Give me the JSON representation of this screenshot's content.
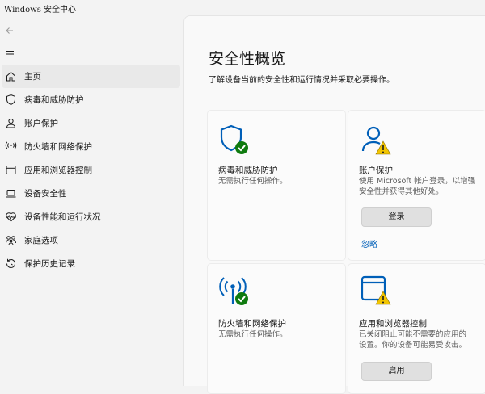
{
  "window": {
    "title": "Windows 安全中心"
  },
  "sidebar": {
    "items": [
      {
        "label": "主页",
        "icon": "home-icon"
      },
      {
        "label": "病毒和威胁防护",
        "icon": "shield-icon"
      },
      {
        "label": "账户保护",
        "icon": "person-icon"
      },
      {
        "label": "防火墙和网络保护",
        "icon": "antenna-icon"
      },
      {
        "label": "应用和浏览器控制",
        "icon": "app-window-icon"
      },
      {
        "label": "设备安全性",
        "icon": "laptop-icon"
      },
      {
        "label": "设备性能和运行状况",
        "icon": "heart-pulse-icon"
      },
      {
        "label": "家庭选项",
        "icon": "family-icon"
      },
      {
        "label": "保护历史记录",
        "icon": "history-icon"
      }
    ]
  },
  "main": {
    "title": "安全性概览",
    "subtitle": "了解设备当前的安全性和运行情况并采取必要操作。",
    "cards": [
      {
        "title": "病毒和威胁防护",
        "desc": [
          "无需执行任何操作。"
        ],
        "status": "ok"
      },
      {
        "title": "账户保护",
        "desc": [
          "使用 Microsoft 帐户登录，以增强",
          "安全性并获得其他好处。"
        ],
        "status": "warning",
        "button": "登录",
        "link": "忽略"
      },
      {
        "title": "防火墙和网络保护",
        "desc": [
          "无需执行任何操作。"
        ],
        "status": "ok"
      },
      {
        "title": "应用和浏览器控制",
        "desc": [
          "已关闭阻止可能不需要的应用的",
          "设置。你的设备可能易受攻击。"
        ],
        "status": "warning",
        "button": "启用"
      }
    ]
  },
  "colors": {
    "accent": "#005fb8",
    "ok": "#0f7b0f",
    "warning": "#f2c500"
  }
}
